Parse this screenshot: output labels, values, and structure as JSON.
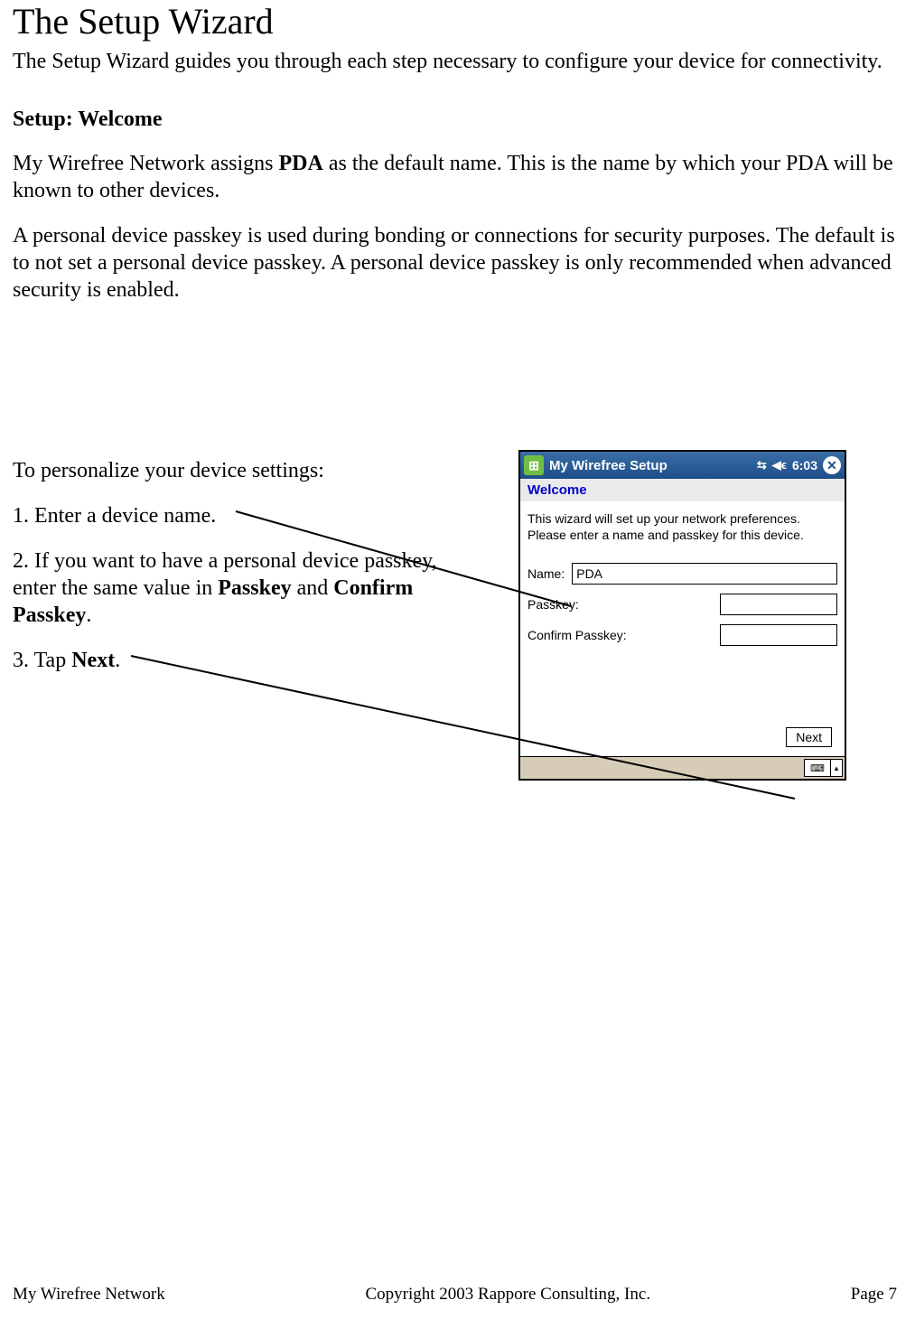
{
  "title": "The Setup Wizard",
  "intro": "The Setup Wizard guides you through each step necessary to configure your device for connectivity.",
  "section_heading": "Setup: Welcome",
  "para1_pre": "My Wirefree Network assigns ",
  "para1_bold": "PDA",
  "para1_post": " as the default name. This is the name by which your PDA will be known to other devices.",
  "para2": "A personal device passkey is used during bonding or connections for security purposes. The default is to not set a personal device passkey. A personal device passkey is only recommended when advanced security is enabled.",
  "steps": {
    "lead": "To personalize your device settings:",
    "s1": "1. Enter a device name.",
    "s2_pre": "2. If you want to have a personal device passkey, enter the same value in ",
    "s2_b1": "Passkey",
    "s2_mid": " and ",
    "s2_b2": "Confirm Passkey",
    "s2_post": ".",
    "s3_pre": "3. Tap ",
    "s3_b": "Next",
    "s3_post": "."
  },
  "device": {
    "titlebar": "My Wirefree Setup",
    "time": "6:03",
    "section": "Welcome",
    "helptext": "This wizard will set up your network preferences. Please enter a name and passkey for this device.",
    "name_label": "Name:",
    "name_value": "PDA",
    "passkey_label": "Passkey:",
    "confirm_label": "Confirm Passkey:",
    "next": "Next"
  },
  "footer": {
    "left": "My Wirefree Network",
    "center": "Copyright 2003 Rappore Consulting, Inc.",
    "right": "Page 7"
  }
}
